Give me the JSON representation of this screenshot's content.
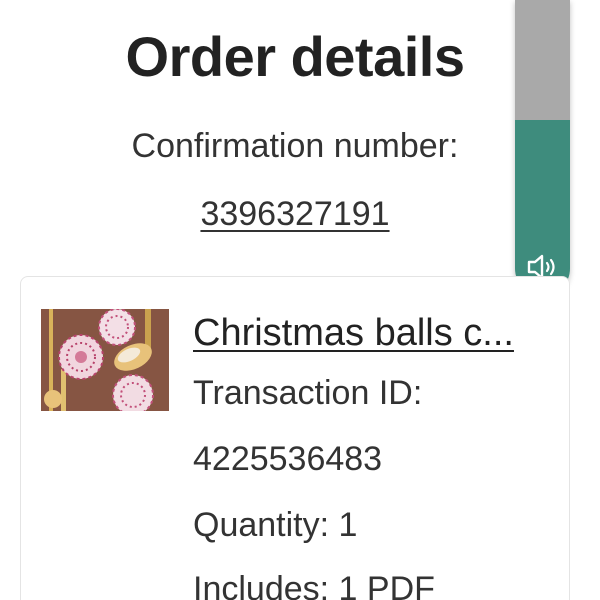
{
  "header": {
    "title": "Order details",
    "confirmation_label": "Confirmation number:",
    "confirmation_number": "3396327191"
  },
  "side_widget": {
    "icon": "speaker-icon",
    "colors": {
      "accent": "#3e8c7d",
      "track": "#a9a9a9"
    }
  },
  "order_item": {
    "title": "Christmas balls c...",
    "thumbnail_icon": "christmas-ornaments-thumbnail",
    "transaction_label": "Transaction ID:",
    "transaction_id": "4225536483",
    "quantity_label": "Quantity:",
    "quantity": "1",
    "includes_label": "Includes:",
    "includes": "1 PDF"
  }
}
